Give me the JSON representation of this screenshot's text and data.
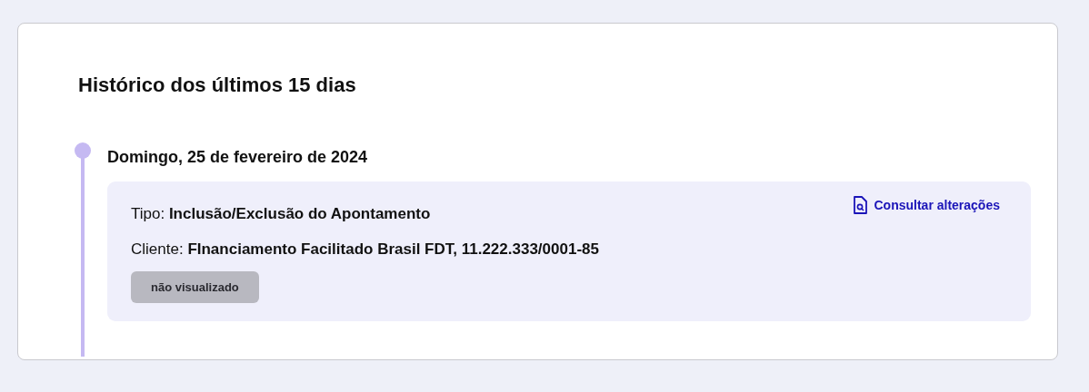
{
  "history": {
    "title": "Histórico dos últimos 15 dias",
    "days": [
      {
        "date": "Domingo, 25 de fevereiro de 2024",
        "events": [
          {
            "lines": [
              "Tipo: **Inclusão/Exclusão do Apontamento**",
              "Cliente: **FInanciamento Facilitado Brasil FDT, 11.222.333/0001-85**"
            ],
            "action": "Consultar alterações",
            "status": "não visualizado",
            "viewed": false
          }
        ]
      }
    ]
  }
}
